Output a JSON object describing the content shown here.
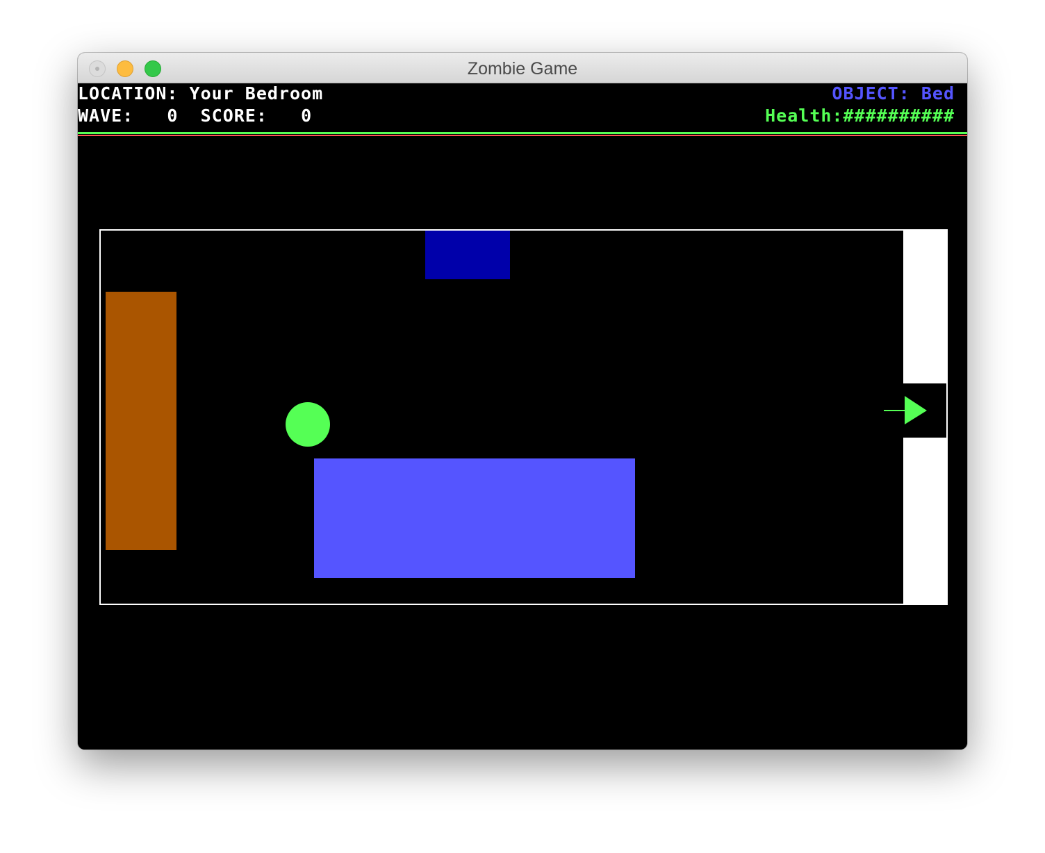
{
  "window": {
    "title": "Zombie Game"
  },
  "hud": {
    "location_label": "LOCATION:",
    "location_value": "Your Bedroom",
    "wave_label": "WAVE:",
    "wave_value": "0",
    "score_label": "SCORE:",
    "score_value": "0",
    "object_label": "OBJECT:",
    "object_value": "Bed",
    "health_label": "Health:",
    "health_bar": "##########"
  },
  "colors": {
    "background": "#000000",
    "hud_text": "#ffffff",
    "object_text": "#5555ff",
    "health_text": "#55ff55",
    "separator_green": "#55ff55",
    "separator_red": "#ff5555",
    "room_border": "#ffffff",
    "player": "#55ff55",
    "dresser": "#aa5500",
    "nightstand": "#0000aa",
    "bed": "#5555ff",
    "exit_arrow": "#55ff55"
  },
  "room": {
    "objects": [
      {
        "id": "dresser",
        "color_key": "dresser"
      },
      {
        "id": "nightstand",
        "color_key": "nightstand"
      },
      {
        "id": "bed",
        "color_key": "bed"
      }
    ],
    "exit": {
      "direction": "right",
      "icon": "arrow-right-icon"
    }
  }
}
